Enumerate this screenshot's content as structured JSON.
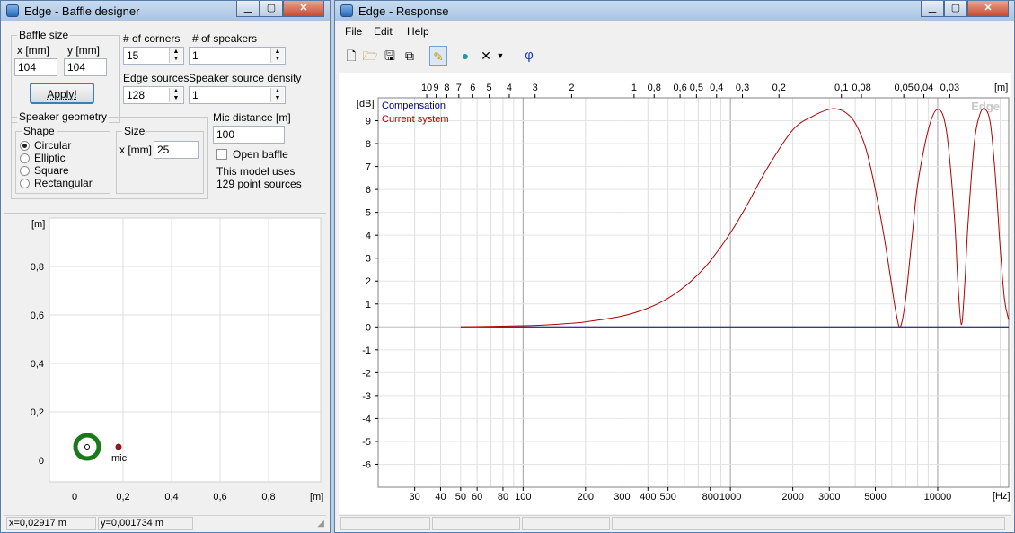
{
  "left_window": {
    "title": "Edge - Baffle designer",
    "baffle_size": {
      "label": "Baffle size",
      "x_label": "x [mm]",
      "y_label": "y [mm]",
      "x_value": "104",
      "y_value": "104",
      "apply_label": "Apply!"
    },
    "corners": {
      "label": "# of corners",
      "value": "15"
    },
    "speakers": {
      "label": "# of speakers",
      "value": "1"
    },
    "edge_sources": {
      "label": "Edge sources",
      "value": "128"
    },
    "density": {
      "label": "Speaker source density",
      "value": "1"
    },
    "geometry": {
      "label": "Speaker geometry",
      "shape_label": "Shape",
      "options": [
        "Circular",
        "Elliptic",
        "Square",
        "Rectangular"
      ],
      "selected": "Circular",
      "size_label": "Size",
      "size_x_label": "x [mm]",
      "size_value": "25"
    },
    "mic": {
      "label": "Mic distance [m]",
      "value": "100",
      "open_baffle_label": "Open baffle",
      "open_baffle_checked": false
    },
    "model_info": {
      "line1": "This model uses",
      "line2": "129 point sources"
    },
    "plot": {
      "y_unit": "[m]",
      "x_unit": "[m]",
      "y_ticks": [
        "0,8",
        "0,6",
        "0,4",
        "0,2",
        "0"
      ],
      "x_ticks": [
        "0",
        "0,2",
        "0,4",
        "0,6",
        "0,8"
      ],
      "mic_label": "mic",
      "speaker_color": "#1a7a1a",
      "mic_color": "#8b1a1a"
    },
    "status": {
      "x": "x=0,02917 m",
      "y": "y=0,001734 m"
    }
  },
  "right_window": {
    "title": "Edge - Response",
    "menu": [
      "File",
      "Edit",
      "Help"
    ],
    "toolbar_icons": [
      "new-file-icon",
      "open-folder-icon",
      "save-icon",
      "copy-icon",
      "pencil-icon",
      "speaker-icon",
      "delete-icon",
      "dropdown-arrow-icon",
      "phase-icon"
    ],
    "phase_glyph": "φ",
    "chart_data": {
      "type": "line",
      "x_scale": "log",
      "xlabel": "[Hz]",
      "ylabel": "[dB]",
      "x_range": [
        20,
        22000
      ],
      "y_range": [
        -7,
        10
      ],
      "y_ticks": [
        9,
        8,
        7,
        6,
        5,
        4,
        3,
        2,
        1,
        0,
        -1,
        -2,
        -3,
        -4,
        -5,
        -6
      ],
      "x_ticks": [
        {
          "value": 30,
          "label": "30"
        },
        {
          "value": 40,
          "label": "40"
        },
        {
          "value": 50,
          "label": "50"
        },
        {
          "value": 60,
          "label": "60"
        },
        {
          "value": 80,
          "label": "80"
        },
        {
          "value": 100,
          "label": "100"
        },
        {
          "value": 200,
          "label": "200"
        },
        {
          "value": 300,
          "label": "300"
        },
        {
          "value": 400,
          "label": "400"
        },
        {
          "value": 500,
          "label": "500"
        },
        {
          "value": 800,
          "label": "800"
        },
        {
          "value": 1000,
          "label": "1000"
        },
        {
          "value": 2000,
          "label": "2000"
        },
        {
          "value": 3000,
          "label": "3000"
        },
        {
          "value": 5000,
          "label": "5000"
        },
        {
          "value": 10000,
          "label": "10000"
        }
      ],
      "top_axis_unit": "[m]",
      "top_ticks": [
        {
          "freq": 34.3,
          "label": "10"
        },
        {
          "freq": 38.1,
          "label": "9"
        },
        {
          "freq": 42.9,
          "label": "8"
        },
        {
          "freq": 49,
          "label": "7"
        },
        {
          "freq": 57.2,
          "label": "6"
        },
        {
          "freq": 68.6,
          "label": "5"
        },
        {
          "freq": 85.8,
          "label": "4"
        },
        {
          "freq": 114.3,
          "label": "3"
        },
        {
          "freq": 171.5,
          "label": "2"
        },
        {
          "freq": 343,
          "label": "1"
        },
        {
          "freq": 428.8,
          "label": "0,8"
        },
        {
          "freq": 571.7,
          "label": "0,6"
        },
        {
          "freq": 686,
          "label": "0,5"
        },
        {
          "freq": 857.5,
          "label": "0,4"
        },
        {
          "freq": 1143,
          "label": "0,3"
        },
        {
          "freq": 1715,
          "label": "0,2"
        },
        {
          "freq": 3430,
          "label": "0,1"
        },
        {
          "freq": 4288,
          "label": "0,08"
        },
        {
          "freq": 6860,
          "label": "0,05"
        },
        {
          "freq": 8575,
          "label": "0,04"
        },
        {
          "freq": 11433,
          "label": "0,03"
        }
      ],
      "watermark": "Edge",
      "series": [
        {
          "name": "Compensation",
          "color": "#00007f",
          "x": [
            50,
            22000
          ],
          "y": [
            0,
            0
          ]
        },
        {
          "name": "Current system",
          "color": "#b00000",
          "x": [
            50,
            100,
            150,
            200,
            300,
            400,
            500,
            600,
            700,
            800,
            1000,
            1200,
            1500,
            2000,
            2500,
            3000,
            3300,
            3600,
            4000,
            4500,
            5000,
            5500,
            6000,
            6300,
            6600,
            7000,
            7500,
            8000,
            9000,
            10000,
            11000,
            12000,
            12500,
            13000,
            13500,
            14000,
            15000,
            16000,
            17000,
            18000,
            19000,
            20000,
            21000,
            22000
          ],
          "y": [
            0,
            0.05,
            0.12,
            0.22,
            0.47,
            0.82,
            1.25,
            1.75,
            2.3,
            2.88,
            4.1,
            5.3,
            6.9,
            8.6,
            9.2,
            9.5,
            9.5,
            9.35,
            8.9,
            7.8,
            6.0,
            4.0,
            1.8,
            0.6,
            0.0,
            1.2,
            3.8,
            6.2,
            8.6,
            9.5,
            8.6,
            5.0,
            2.0,
            0.1,
            1.8,
            4.5,
            8.0,
            9.3,
            9.5,
            8.8,
            6.5,
            3.5,
            1.2,
            0.3
          ]
        }
      ]
    }
  }
}
